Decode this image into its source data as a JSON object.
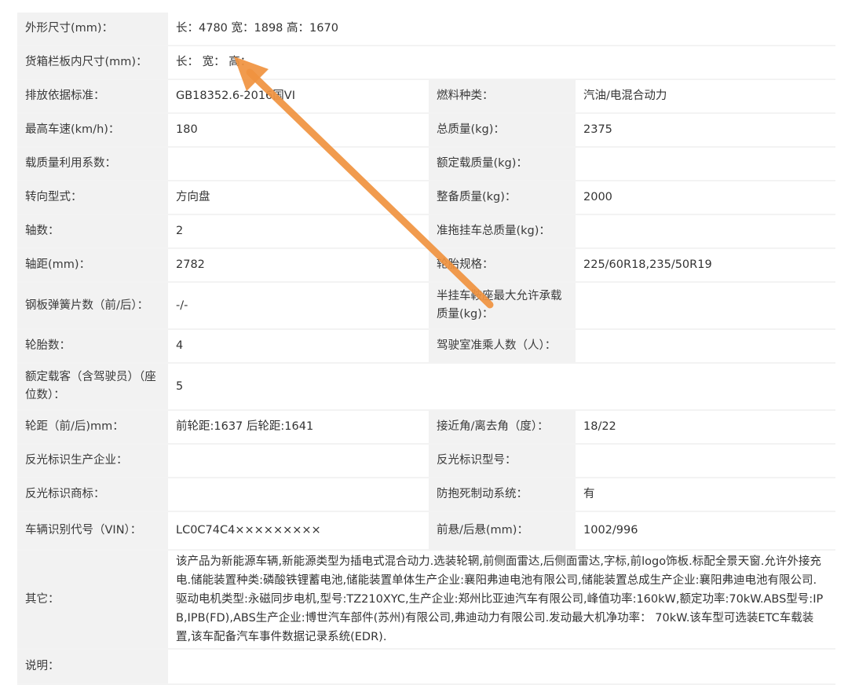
{
  "rows": [
    {
      "l1": "外形尺寸(mm)：",
      "v1": "长：4780 宽：1898 高：1670"
    },
    {
      "l1": "货箱栏板内尺寸(mm)：",
      "v1": "长： 宽： 高："
    },
    {
      "l1": "排放依据标准：",
      "v1": "GB18352.6-2016国VI",
      "l2": "燃料种类：",
      "v2": "汽油/电混合动力"
    },
    {
      "l1": "最高车速(km/h)：",
      "v1": "180",
      "l2": "总质量(kg)：",
      "v2": "2375"
    },
    {
      "l1": "载质量利用系数：",
      "v1": "",
      "l2": "额定载质量(kg)：",
      "v2": ""
    },
    {
      "l1": "转向型式：",
      "v1": "方向盘",
      "l2": "整备质量(kg)：",
      "v2": "2000"
    },
    {
      "l1": "轴数：",
      "v1": "2",
      "l2": "准拖挂车总质量(kg)：",
      "v2": ""
    },
    {
      "l1": "轴距(mm)：",
      "v1": "2782",
      "l2": "轮胎规格：",
      "v2": "225/60R18,235/50R19"
    },
    {
      "l1": "钢板弹簧片数（前/后）：",
      "v1": "-/-",
      "l2": "半挂车鞍座最大允许承载质量(kg)：",
      "v2": ""
    },
    {
      "l1": "轮胎数：",
      "v1": "4",
      "l2": "驾驶室准乘人数（人）：",
      "v2": ""
    },
    {
      "l1": "额定载客（含驾驶员）（座位数）：",
      "v1": "5"
    },
    {
      "l1": "轮距（前/后)mm：",
      "v1": "前轮距:1637 后轮距:1641",
      "l2": "接近角/离去角（度）：",
      "v2": "18/22"
    },
    {
      "l1": "反光标识生产企业：",
      "v1": "",
      "l2": "反光标识型号：",
      "v2": ""
    },
    {
      "l1": "反光标识商标：",
      "v1": "",
      "l2": "防抱死制动系统：",
      "v2": "有"
    },
    {
      "l1": "车辆识别代号（VIN）：",
      "v1": "LC0C74C4×××××××××",
      "l2": "前悬/后悬(mm)：",
      "v2": "1002/996"
    },
    {
      "l1": "其它：",
      "v1": "该产品为新能源车辆,新能源类型为插电式混合动力.选装轮辋,前侧面雷达,后侧面雷达,字标,前logo饰板.标配全景天窗.允许外接充电.储能装置种类:磷酸铁锂蓄电池,储能装置单体生产企业:襄阳弗迪电池有限公司,储能装置总成生产企业:襄阳弗迪电池有限公司.驱动电机类型:永磁同步电机,型号:TZ210XYC,生产企业:郑州比亚迪汽车有限公司,峰值功率:160kW,额定功率:70kW.ABS型号:IPB,IPB(FD),ABS生产企业:博世汽车部件(苏州)有限公司,弗迪动力有限公司.发动最大机净功率： 70kW.该车型可选装ETC车载装置,该车配备汽车事件数据记录系统(EDR)."
    },
    {
      "l1": "说明：",
      "v1": ""
    }
  ],
  "annotation": {
    "color": "#f0923f"
  }
}
